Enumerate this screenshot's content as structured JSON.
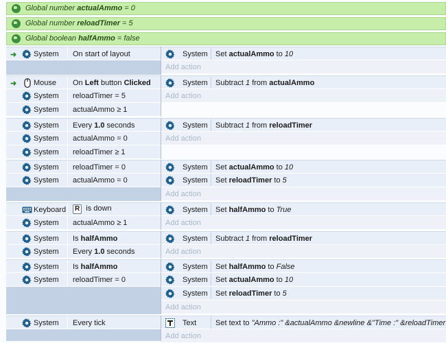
{
  "globals": [
    {
      "prefix": "Global number ",
      "name": "actualAmmo",
      "suffix": " = 0"
    },
    {
      "prefix": "Global number ",
      "name": "reloadTimer",
      "suffix": " = 5"
    },
    {
      "prefix": "Global boolean ",
      "name": "halfAmmo",
      "suffix": " = false"
    }
  ],
  "labels": {
    "system": "System",
    "mouse": "Mouse",
    "keyboard": "Keyboard",
    "text": "Text",
    "add_action": "Add action",
    "trigger_arrow": "➜"
  },
  "events": {
    "e1": {
      "c1": "On start of layout",
      "a1": {
        "pre": "Set ",
        "bold": "actualAmmo",
        "mid": " to ",
        "ital": "10"
      }
    },
    "e2": {
      "c1": {
        "pre": "On ",
        "b1": "Left",
        "mid": " button ",
        "b2": "Clicked"
      },
      "c2": "reloadTimer = 5",
      "c3": "actualAmmo ≥ 1",
      "a1": {
        "pre": "Subtract ",
        "ital": "1",
        "mid": " from ",
        "bold": "actualAmmo"
      }
    },
    "e3": {
      "c1": {
        "pre": "Every ",
        "bold": "1.0",
        "post": " seconds"
      },
      "c2": "actualAmmo = 0",
      "c3": "reloadTimer ≥ 1",
      "a1": {
        "pre": "Subtract ",
        "ital": "1",
        "mid": " from ",
        "bold": "reloadTimer"
      }
    },
    "e4": {
      "c1": "reloadTimer = 0",
      "c2": "actualAmmo = 0",
      "a1": {
        "pre": "Set ",
        "bold": "actualAmmo",
        "mid": " to ",
        "ital": "10"
      },
      "a2": {
        "pre": "Set ",
        "bold": "reloadTimer",
        "mid": " to ",
        "ital": "5"
      }
    },
    "e5": {
      "c1": {
        "key": "R",
        "post": " is down"
      },
      "c2": "actualAmmo ≥ 1",
      "a1": {
        "pre": "Set ",
        "bold": "halfAmmo",
        "mid": " to ",
        "ital": "True"
      }
    },
    "e6": {
      "c1": {
        "pre": "Is ",
        "bold": "halfAmmo"
      },
      "c2": {
        "pre": "Every ",
        "bold": "1.0",
        "post": " seconds"
      },
      "a1": {
        "pre": "Subtract ",
        "ital": "1",
        "mid": " from ",
        "bold": "reloadTimer"
      }
    },
    "e7": {
      "c1": {
        "pre": "Is ",
        "bold": "halfAmmo"
      },
      "c2": "reloadTimer = 0",
      "a1": {
        "pre": "Set ",
        "bold": "halfAmmo",
        "mid": " to ",
        "ital": "False"
      },
      "a2": {
        "pre": "Set ",
        "bold": "actualAmmo",
        "mid": " to ",
        "ital": "10"
      },
      "a3": {
        "pre": "Set ",
        "bold": "reloadTimer",
        "mid": " to ",
        "ital": "5"
      }
    },
    "e8": {
      "c1": "Every tick",
      "a1": {
        "pre": "Set text to ",
        "ital": "\"Ammo :\" &actualAmmo &newline &\"Time :\" &reloadTimer"
      }
    }
  },
  "colors": {
    "global_bg": "#c6edaa",
    "cond_bg": "#e9eff8",
    "gutter": "#c2d2e4",
    "icon": "#1e5e8e"
  }
}
